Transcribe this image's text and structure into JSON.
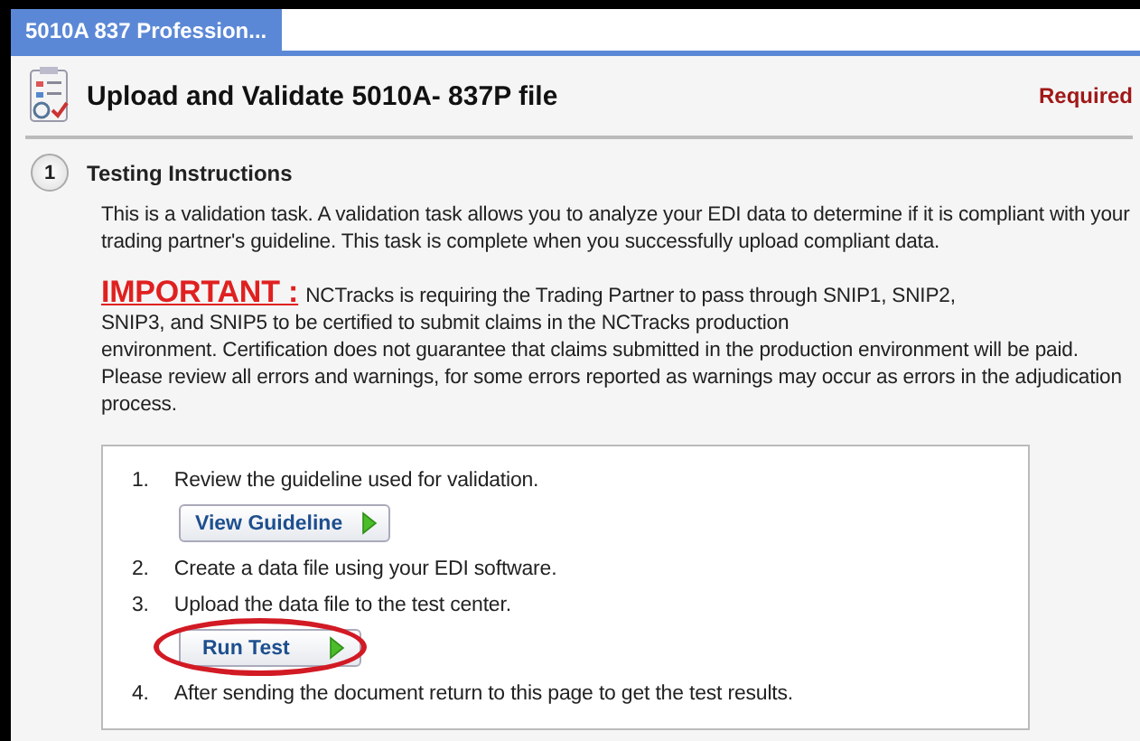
{
  "tab": {
    "label": "5010A 837 Profession...",
    "selected": true
  },
  "task": {
    "title": "Upload and Validate 5010A- 837P file",
    "status": "Required"
  },
  "section": {
    "number": "1",
    "title": "Testing Instructions",
    "intro": "This is a validation task. A validation task allows you to analyze your EDI data to determine if it is compliant with your trading partner's guideline. This task is complete when you successfully upload compliant data.",
    "important_label": "IMPORTANT :",
    "important_text": "NCTracks is requiring the Trading Partner to pass through SNIP1, SNIP2,\nSNIP3, and SNIP5 to be certified to submit claims in the NCTracks production\nenvironment.  Certification does not guarantee that claims submitted in the production environment will be paid.  Please review all errors and warnings, for some errors reported as warnings may occur as errors in the adjudication process."
  },
  "steps": [
    {
      "number": "1.",
      "text": "Review the guideline used for validation.",
      "button": {
        "label": "View Guideline",
        "highlighted": false
      }
    },
    {
      "number": "2.",
      "text": "Create a data file using your EDI software."
    },
    {
      "number": "3.",
      "text": "Upload the data file to the test center.",
      "button": {
        "label": "Run Test",
        "highlighted": true
      }
    },
    {
      "number": "4.",
      "text": "After sending the document return to this page to get the test results."
    }
  ]
}
